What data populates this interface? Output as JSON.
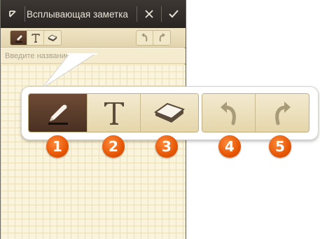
{
  "window": {
    "title": "Всплывающая заметка",
    "title_placeholder": "Введите название"
  },
  "toolbar": {
    "tools": [
      {
        "name": "pen-icon",
        "active": true
      },
      {
        "name": "text-icon",
        "active": false
      },
      {
        "name": "eraser-icon",
        "active": false
      }
    ],
    "history": [
      {
        "name": "undo-icon"
      },
      {
        "name": "redo-icon"
      }
    ]
  },
  "callouts": [
    "1",
    "2",
    "3",
    "4",
    "5"
  ],
  "colors": {
    "titlebar": "#2f2926",
    "active_tool": "#5a3c2b",
    "badge": "#e35300",
    "grid_paper": "#fbf4dc"
  }
}
